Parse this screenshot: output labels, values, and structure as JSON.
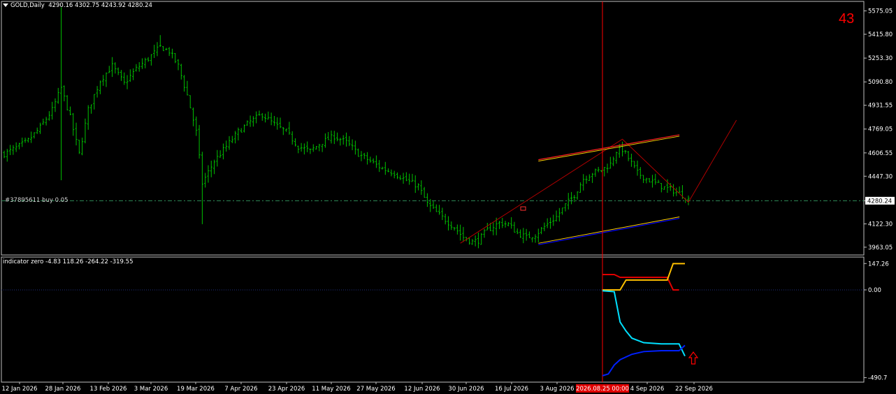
{
  "header": {
    "symbol": "GOLD,Daily",
    "ohlc": "4290.16 4302.75 4243.92 4280.24"
  },
  "counter": "43",
  "position_label": "#37895611 buy 0.05",
  "price_axis": {
    "ticks": [
      "5575.05",
      "5415.80",
      "5253.30",
      "5090.80",
      "4931.55",
      "4769.05",
      "4606.55",
      "4447.30",
      "4280.24",
      "4122.30",
      "3963.05"
    ],
    "current_price": "4280.24",
    "current_color": "#ffffff"
  },
  "indicator_panel": {
    "label": "indicator zero -4.83 118.26 -264.22 -319.55",
    "ticks": [
      "147.26",
      "0.00",
      "-490.7"
    ]
  },
  "time_axis": {
    "labels": [
      "12 Jan 2026",
      "28 Jan 2026",
      "13 Feb 2026",
      "3 Mar 2026",
      "19 Mar 2026",
      "7 Apr 2026",
      "23 Apr 2026",
      "11 May 2026",
      "27 May 2026",
      "12 Jun 2026",
      "30 Jun 2026",
      "16 Jul 2026",
      "3 Aug 2026",
      "4 Sep 2026",
      "22 Sep 2026"
    ],
    "cursor_label": "2026.08.25 00:00"
  },
  "colors": {
    "bars": "#00c000",
    "crosshair": "#ff0000",
    "channel_upper": "#ff2020",
    "channel_lower": "#0000ff",
    "channel_accent": "#ffd000",
    "ind_red": "#e00000",
    "ind_yellow": "#ffc000",
    "ind_cyan": "#00e0ff",
    "ind_blue": "#0020ff"
  },
  "chart_data": {
    "type": "ohlc",
    "timeframe": "Daily",
    "y_ticks": [
      5575.05,
      5415.8,
      5253.3,
      5090.8,
      4931.55,
      4769.05,
      4606.55,
      4447.3,
      4122.3,
      3963.05
    ],
    "ylim": [
      3910,
      5640
    ],
    "current_price": 4280.24,
    "position_price": 4280.24,
    "close_path": [
      [
        0,
        4600
      ],
      [
        4,
        4640
      ],
      [
        8,
        4690
      ],
      [
        12,
        4780
      ],
      [
        16,
        4900
      ],
      [
        19,
        5050
      ],
      [
        22,
        4850
      ],
      [
        25,
        4600
      ],
      [
        28,
        4900
      ],
      [
        32,
        5100
      ],
      [
        36,
        5200
      ],
      [
        40,
        5080
      ],
      [
        44,
        5180
      ],
      [
        48,
        5250
      ],
      [
        52,
        5330
      ],
      [
        55,
        5300
      ],
      [
        58,
        5200
      ],
      [
        61,
        5000
      ],
      [
        64,
        4750
      ],
      [
        66,
        4400
      ],
      [
        70,
        4550
      ],
      [
        74,
        4650
      ],
      [
        78,
        4750
      ],
      [
        82,
        4820
      ],
      [
        86,
        4870
      ],
      [
        90,
        4800
      ],
      [
        94,
        4750
      ],
      [
        98,
        4650
      ],
      [
        102,
        4620
      ],
      [
        106,
        4680
      ],
      [
        110,
        4720
      ],
      [
        114,
        4680
      ],
      [
        118,
        4600
      ],
      [
        122,
        4550
      ],
      [
        126,
        4500
      ],
      [
        130,
        4470
      ],
      [
        134,
        4420
      ],
      [
        138,
        4380
      ],
      [
        141,
        4260
      ],
      [
        144,
        4200
      ],
      [
        147,
        4150
      ],
      [
        150,
        4100
      ],
      [
        153,
        4030
      ],
      [
        156,
        4000
      ],
      [
        158,
        4010
      ],
      [
        161,
        4080
      ],
      [
        165,
        4130
      ],
      [
        168,
        4120
      ],
      [
        171,
        4060
      ],
      [
        174,
        4030
      ],
      [
        177,
        4050
      ],
      [
        181,
        4120
      ],
      [
        184,
        4170
      ],
      [
        187,
        4250
      ],
      [
        190,
        4320
      ],
      [
        193,
        4430
      ],
      [
        196,
        4470
      ],
      [
        199,
        4490
      ],
      [
        202,
        4530
      ],
      [
        204,
        4620
      ],
      [
        206,
        4630
      ],
      [
        208,
        4570
      ],
      [
        211,
        4470
      ],
      [
        214,
        4430
      ],
      [
        217,
        4400
      ],
      [
        220,
        4370
      ],
      [
        223,
        4350
      ],
      [
        226,
        4320
      ],
      [
        228,
        4290
      ]
    ],
    "n_bars": 229,
    "channel": {
      "upper": [
        [
          178,
          4560
        ],
        [
          225,
          4730
        ]
      ],
      "lower": [
        [
          178,
          3980
        ],
        [
          225,
          4160
        ]
      ]
    },
    "triangle": [
      [
        152,
        3990
      ],
      [
        206,
        4700
      ],
      [
        228,
        4270
      ],
      [
        244,
        4830
      ]
    ],
    "indicator": {
      "ylim": [
        -500,
        160
      ],
      "ticks": [
        147.26,
        0.0,
        -490.7
      ],
      "series": [
        {
          "color": "#e00000",
          "points": [
            [
              0,
              86
            ],
            [
              4,
              86
            ],
            [
              6,
              70
            ],
            [
              12,
              70
            ],
            [
              18,
              70
            ],
            [
              22,
              70
            ],
            [
              24,
              0
            ],
            [
              26,
              0
            ]
          ]
        },
        {
          "color": "#ffc000",
          "points": [
            [
              0,
              0
            ],
            [
              6,
              0
            ],
            [
              8,
              55
            ],
            [
              12,
              55
            ],
            [
              18,
              55
            ],
            [
              22,
              55
            ],
            [
              24,
              147
            ],
            [
              28,
              147
            ]
          ]
        },
        {
          "color": "#00e0ff",
          "points": [
            [
              0,
              -5
            ],
            [
              4,
              -10
            ],
            [
              6,
              -180
            ],
            [
              8,
              -230
            ],
            [
              10,
              -270
            ],
            [
              14,
              -295
            ],
            [
              20,
              -302
            ],
            [
              26,
              -302
            ],
            [
              28,
              -370
            ]
          ]
        },
        {
          "color": "#0020ff",
          "points": [
            [
              0,
              -480
            ],
            [
              2,
              -470
            ],
            [
              4,
              -420
            ],
            [
              6,
              -390
            ],
            [
              10,
              -360
            ],
            [
              14,
              -345
            ],
            [
              20,
              -340
            ],
            [
              26,
              -340
            ],
            [
              28,
              -310
            ]
          ]
        }
      ]
    }
  }
}
